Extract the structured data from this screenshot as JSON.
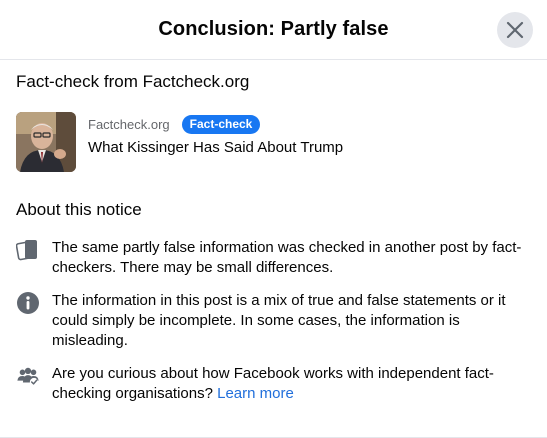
{
  "dialog": {
    "title": "Conclusion: Partly false"
  },
  "factcheck": {
    "heading": "Fact-check from Factcheck.org",
    "source": "Factcheck.org",
    "badge": "Fact-check",
    "headline": "What Kissinger Has Said About Trump",
    "thumbnail_icon": "article-thumbnail-photo"
  },
  "about": {
    "heading": "About this notice",
    "items": [
      {
        "icon": "duplicate-posts-icon",
        "text": "The same partly false information was checked in another post by fact-checkers. There may be small differences."
      },
      {
        "icon": "info-icon",
        "text": "The information in this post is a mix of true and false statements or it could simply be incomplete. In some cases, the information is misleading."
      },
      {
        "icon": "people-check-icon",
        "text": "Are you curious about how Facebook works with independent fact-checking organisations?",
        "link": "Learn more"
      }
    ]
  },
  "colors": {
    "accent": "#1877f2",
    "link": "#216fdb",
    "secondary_text": "#65676b",
    "icon": "#606770"
  }
}
